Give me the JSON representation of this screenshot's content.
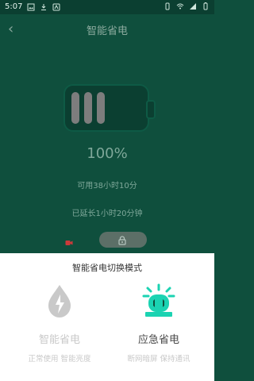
{
  "status": {
    "time": "5:07"
  },
  "app": {
    "title": "智能省电"
  },
  "battery": {
    "percent_text": "100%",
    "available_time": "可用38小时10分",
    "extended_time": "已延长1小时20分钟"
  },
  "sheet": {
    "title": "智能省电切换模式",
    "modes": [
      {
        "name": "智能省电",
        "desc": "正常使用 智能亮度"
      },
      {
        "name": "应急省电",
        "desc": "断网暗屏 保持通讯"
      }
    ]
  },
  "colors": {
    "background_green": "#0f4f3d",
    "accent_teal": "#1bd3b2",
    "battery_bars": "#7d7d7d",
    "disabled_gray": "#c9c9c9"
  },
  "icons": {
    "back": "back-chevron-icon",
    "water_drop_bolt": "water-drop-bolt-icon",
    "alarm_light": "alarm-light-icon",
    "lock": "lock-icon",
    "video": "video-icon"
  }
}
